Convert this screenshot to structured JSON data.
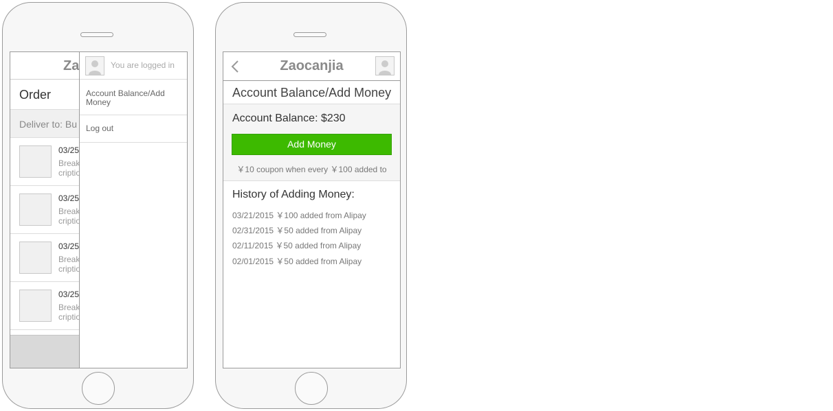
{
  "app": {
    "name": "Zaocanjia"
  },
  "screen1": {
    "header_logo_visible": "Za",
    "order_title": "Order",
    "deliver_to": "Deliver to: Bu",
    "orders": [
      {
        "date": "03/25",
        "desc_line1": "Break",
        "desc_line2": "criptio"
      },
      {
        "date": "03/25",
        "desc_line1": "Break",
        "desc_line2": "criptio"
      },
      {
        "date": "03/25",
        "desc_line1": "Break",
        "desc_line2": "criptio"
      },
      {
        "date": "03/25",
        "desc_line1": "Break",
        "desc_line2": "criptio"
      }
    ],
    "drawer": {
      "logged_in_text": "You are logged in",
      "menu": [
        {
          "label": "Account Balance/Add Money"
        },
        {
          "label": "Log out"
        }
      ]
    }
  },
  "screen2": {
    "header_title": "Zaocanjia",
    "page_title": "Account Balance/Add Money",
    "balance_label": "Account Balance: $230",
    "add_money_button": "Add Money",
    "coupon_note": "￥10 coupon when every ￥100 added to",
    "history_title": "History of Adding Money:",
    "history": [
      "03/21/2015 ￥100 added from Alipay",
      "02/31/2015 ￥50 added from Alipay",
      "02/11/2015 ￥50 added from Alipay",
      "02/01/2015 ￥50 added from Alipay"
    ]
  },
  "colors": {
    "accent_green": "#3dba00",
    "wireframe_border": "#9a9a9a",
    "muted_text": "#8a8a8a"
  },
  "icons": [
    "user-avatar-icon",
    "back-chevron-icon"
  ]
}
